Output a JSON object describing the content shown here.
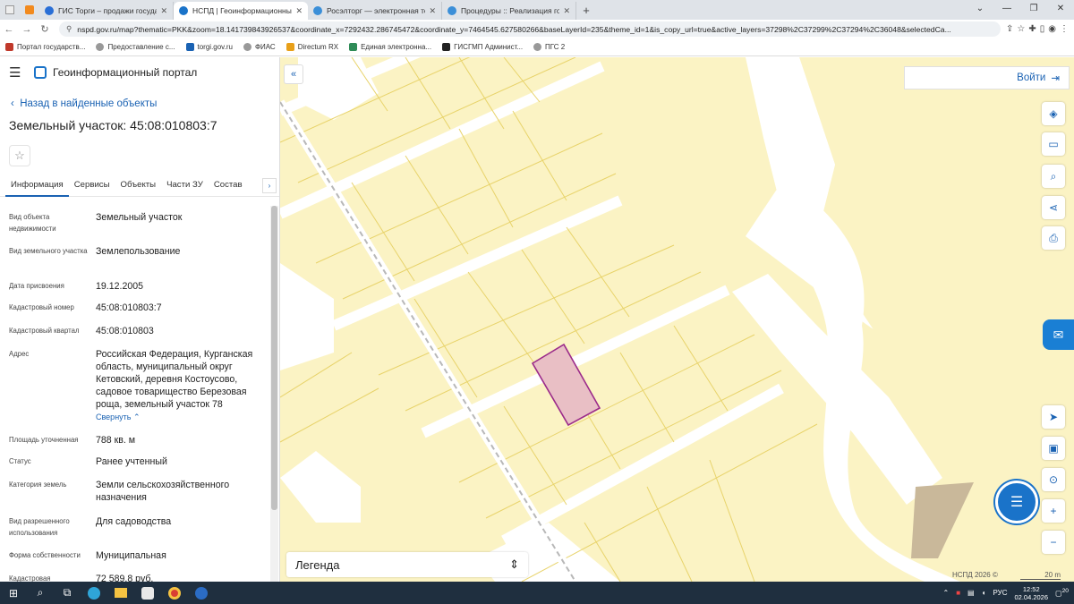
{
  "browser": {
    "tabs": [
      {
        "title": "ГИС Торги – продажи государст",
        "active": false
      },
      {
        "title": "НСПД | Геоинформационный п",
        "active": true
      },
      {
        "title": "Росэлторг — электронная торго",
        "active": false
      },
      {
        "title": "Процедуры :: Реализация госи",
        "active": false
      }
    ],
    "url": "nspd.gov.ru/map?thematic=PKK&zoom=18.141739843926537&coordinate_x=7292432.286745472&coordinate_y=7464545.627580266&baseLayerId=235&theme_id=1&is_copy_url=true&active_layers=37298%2C37299%2C37294%2C36048&selectedCa...",
    "bookmarks": [
      "Портал государств...",
      "Предоставление с...",
      "torgi.gov.ru",
      "ФИАС",
      "Directum RX",
      "Единая электронна...",
      "ГИСГМП Админист...",
      "ПГС 2"
    ]
  },
  "header": {
    "portal_title": "Геоинформационный портал"
  },
  "panel": {
    "back_label": "Назад в найденные объекты",
    "object_title": "Земельный участок: 45:08:010803:7",
    "tabs": [
      "Информация",
      "Сервисы",
      "Объекты",
      "Части ЗУ",
      "Состав"
    ],
    "props": [
      {
        "label": "Вид объекта недвижимости",
        "value": "Земельный участок"
      },
      {
        "label": "Вид земельного участка",
        "value": "Землепользование"
      },
      {
        "label": "Дата присвоения",
        "value": "19.12.2005"
      },
      {
        "label": "Кадастровый номер",
        "value": "45:08:010803:7"
      },
      {
        "label": "Кадастровый квартал",
        "value": "45:08:010803"
      },
      {
        "label": "Адрес",
        "value": "Российская Федерация, Курганская область, муниципальный округ Кетовский, деревня Костоусово, садовое товарищество Березовая роща, земельный участок 78"
      },
      {
        "label": "Площадь уточненная",
        "value": "788 кв. м"
      },
      {
        "label": "Статус",
        "value": "Ранее учтенный"
      },
      {
        "label": "Категория земель",
        "value": "Земли сельскохозяйственного назначения"
      },
      {
        "label": "Вид разрешенного использования",
        "value": "Для садоводства"
      },
      {
        "label": "Форма собственности",
        "value": "Муниципальная"
      },
      {
        "label": "Кадастровая",
        "value": "72 589,8 руб."
      }
    ],
    "collapse_label": "Свернуть"
  },
  "map": {
    "login_label": "Войти",
    "legend_label": "Легенда",
    "attribution": "НСПД 2026 ©",
    "scale_label": "20 m",
    "colors": {
      "parcel_fill": "#fbf3c4",
      "parcel_line": "#e8d36a",
      "selected_fill": "#e9bfc5",
      "selected_line": "#9b2a8a",
      "accent": "#1a62b3"
    }
  },
  "taskbar": {
    "lang": "РУС",
    "time": "12:52",
    "date": "02.04.2026",
    "badge": "20"
  }
}
